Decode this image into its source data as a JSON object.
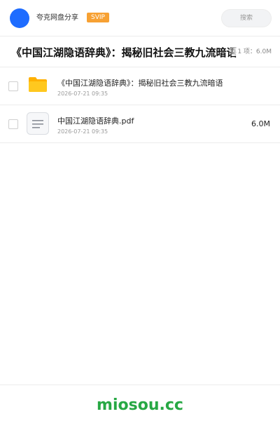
{
  "header": {
    "user_name": "夸克网盘分享",
    "vip_label": "SVIP",
    "search_placeholder": "搜索"
  },
  "title_bar": {
    "title": "《中国江湖隐语辞典》：揭秘旧社会三教九流暗语",
    "meta": "1 项：6.0M"
  },
  "files": [
    {
      "type": "folder",
      "name": "《中国江湖隐语辞典》：揭秘旧社会三教九流暗语",
      "date": "2026-07-21 09:35",
      "size": ""
    },
    {
      "type": "document",
      "name": "中国江湖隐语辞典.pdf",
      "date": "2026-07-21 09:35",
      "size": "6.0M"
    }
  ],
  "footer": {
    "watermark": "miosou.cc"
  },
  "colors": {
    "avatar": "#1e6cff",
    "vip": "#f7a133",
    "folder": "#ffc81f",
    "watermark": "#27a844"
  },
  "icons": [
    "folder-icon",
    "document-icon"
  ]
}
